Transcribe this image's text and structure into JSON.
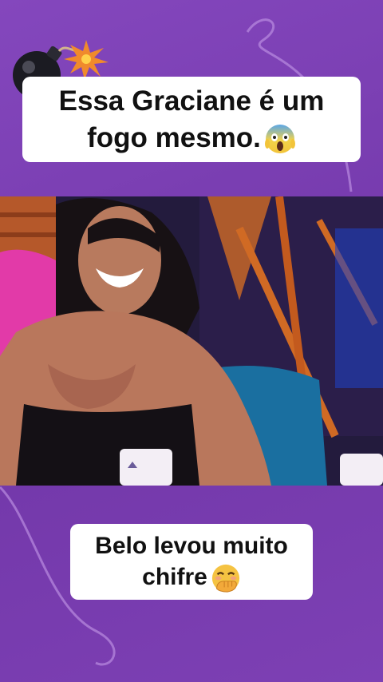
{
  "top_caption": {
    "line1": "Essa Graciane é um",
    "line2": "fogo mesmo.",
    "emoji": "scream-emoji"
  },
  "bottom_caption": {
    "line1": "Belo levou muito",
    "line2": "chifre",
    "emoji": "hand-over-mouth-emoji"
  },
  "colors": {
    "background": "#7b3fb0",
    "caption_bg": "#ffffff",
    "caption_text": "#111111"
  }
}
